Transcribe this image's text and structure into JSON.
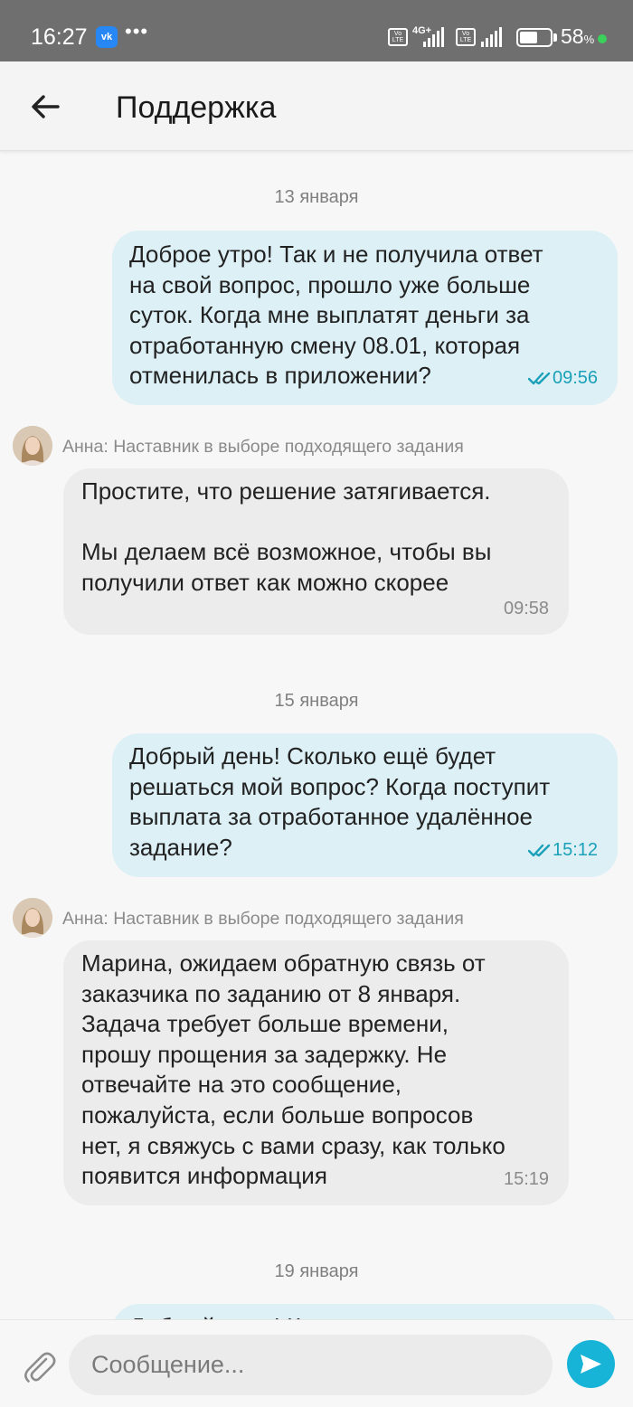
{
  "status_bar": {
    "time": "16:27",
    "vk_label": "vk",
    "more": "•••",
    "volte": "Vo\nLTE",
    "network": "4G+",
    "battery_percent": "58",
    "battery_unit": "%",
    "battery_level": 0.58
  },
  "header": {
    "title": "Поддержка"
  },
  "messages": [
    {
      "date": "13 января"
    },
    {
      "text": "Доброе утро! Так и не получила ответ\nна свой вопрос, прошло уже больше\nсуток. Когда мне выплатят деньги за\nотработанную смену 08.01, которая\nотменилась в приложении?",
      "time": "09:56"
    },
    {
      "sender": "Анна: Наставник в выборе подходящего задания",
      "text": "Простите, что решение затягивается.\n\nМы делаем всё возможное, чтобы вы\nполучили ответ как можно скорее",
      "time": "09:58"
    },
    {
      "date": "15 января"
    },
    {
      "text": "Добрый день! Сколько ещё будет\nрешаться мой вопрос? Когда поступит\nвыплата за отработанное удалённое\nзадание?",
      "time": "15:12"
    },
    {
      "sender": "Анна: Наставник в выборе подходящего задания",
      "text": "Марина, ожидаем обратную связь от\nзаказчика по заданию от 8 января.\nЗадача требует больше времени,\nпрошу прощения за задержку. Не\nотвечайте на это сообщение,\nпожалуйста, если больше вопросов\nнет, я свяжусь с вами сразу, как только\nпоявится информация",
      "time": "15:19"
    },
    {
      "date": "19 января"
    },
    {
      "text": "Добрый день! К"
    }
  ],
  "composer": {
    "placeholder": "Сообщение..."
  },
  "colors": {
    "outgoing_bubble": "#dcf0f6",
    "incoming_bubble": "#ececec",
    "accent": "#18b4d8",
    "time_outgoing": "#1aa0b8"
  },
  "icons": {
    "back": "arrow-left-icon",
    "read_status": "double-check-icon",
    "attach": "paperclip-icon",
    "send": "send-icon"
  }
}
